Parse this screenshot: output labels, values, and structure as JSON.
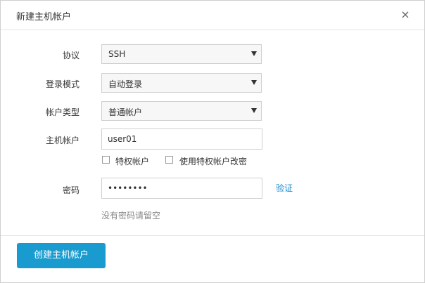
{
  "dialog": {
    "title": "新建主机帐户",
    "close_symbol": "×"
  },
  "form": {
    "protocol": {
      "label": "协议",
      "value": "SSH"
    },
    "login_mode": {
      "label": "登录模式",
      "value": "自动登录"
    },
    "account_type": {
      "label": "帐户类型",
      "value": "普通帐户"
    },
    "host_account": {
      "label": "主机帐户",
      "value": "user01"
    },
    "privileged_checkbox": {
      "label": "特权帐户",
      "checked": false
    },
    "use_privileged_checkbox": {
      "label": "使用特权帐户改密",
      "checked": false
    },
    "password": {
      "label": "密码",
      "value": "••••••••"
    },
    "verify_link": "验证",
    "password_hint": "没有密码请留空"
  },
  "footer": {
    "create_button": "创建主机帐户"
  },
  "colors": {
    "primary": "#1a9bcf",
    "link": "#1a8bd0"
  }
}
